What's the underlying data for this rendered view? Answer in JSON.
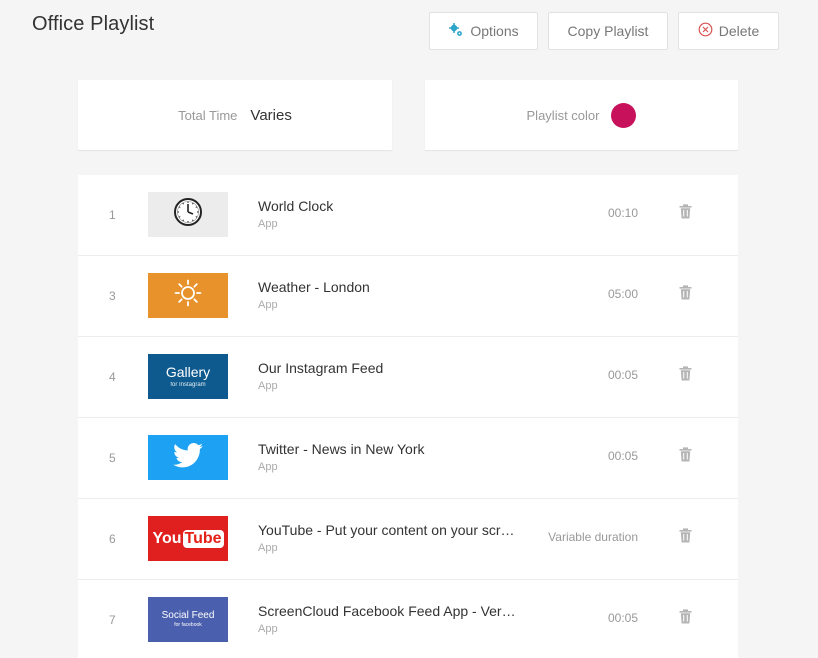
{
  "header": {
    "title": "Office Playlist",
    "options_label": "Options",
    "copy_label": "Copy Playlist",
    "delete_label": "Delete"
  },
  "summary": {
    "total_time_label": "Total Time",
    "total_time_value": "Varies",
    "playlist_color_label": "Playlist color",
    "playlist_color": "#c8115b"
  },
  "items": [
    {
      "number": "1",
      "name": "World Clock",
      "type": "App",
      "duration": "00:10",
      "icon": "clock-icon",
      "bg": "#ececec"
    },
    {
      "number": "3",
      "name": "Weather - London",
      "type": "App",
      "duration": "05:00",
      "icon": "sun-icon",
      "bg": "#e8922b"
    },
    {
      "number": "4",
      "name": "Our Instagram Feed",
      "type": "App",
      "duration": "00:05",
      "icon": "gallery-logo",
      "bg": "#0e5a8e",
      "thumb_text": "Gallery",
      "thumb_sub": "for Instagram"
    },
    {
      "number": "5",
      "name": "Twitter - News in New York",
      "type": "App",
      "duration": "00:05",
      "icon": "twitter-bird-icon",
      "bg": "#1da1f2"
    },
    {
      "number": "6",
      "name": "YouTube - Put your content on your scre…",
      "type": "App",
      "duration": "Variable duration",
      "icon": "youtube-logo",
      "bg": "#e01f1f",
      "thumb_text": "You",
      "thumb_sub": "Tube"
    },
    {
      "number": "7",
      "name": "ScreenCloud Facebook Feed App - Versi…",
      "type": "App",
      "duration": "00:05",
      "icon": "social-feed-logo",
      "bg": "#4a5fad",
      "thumb_text": "Social Feed",
      "thumb_sub": "for facebook"
    }
  ]
}
